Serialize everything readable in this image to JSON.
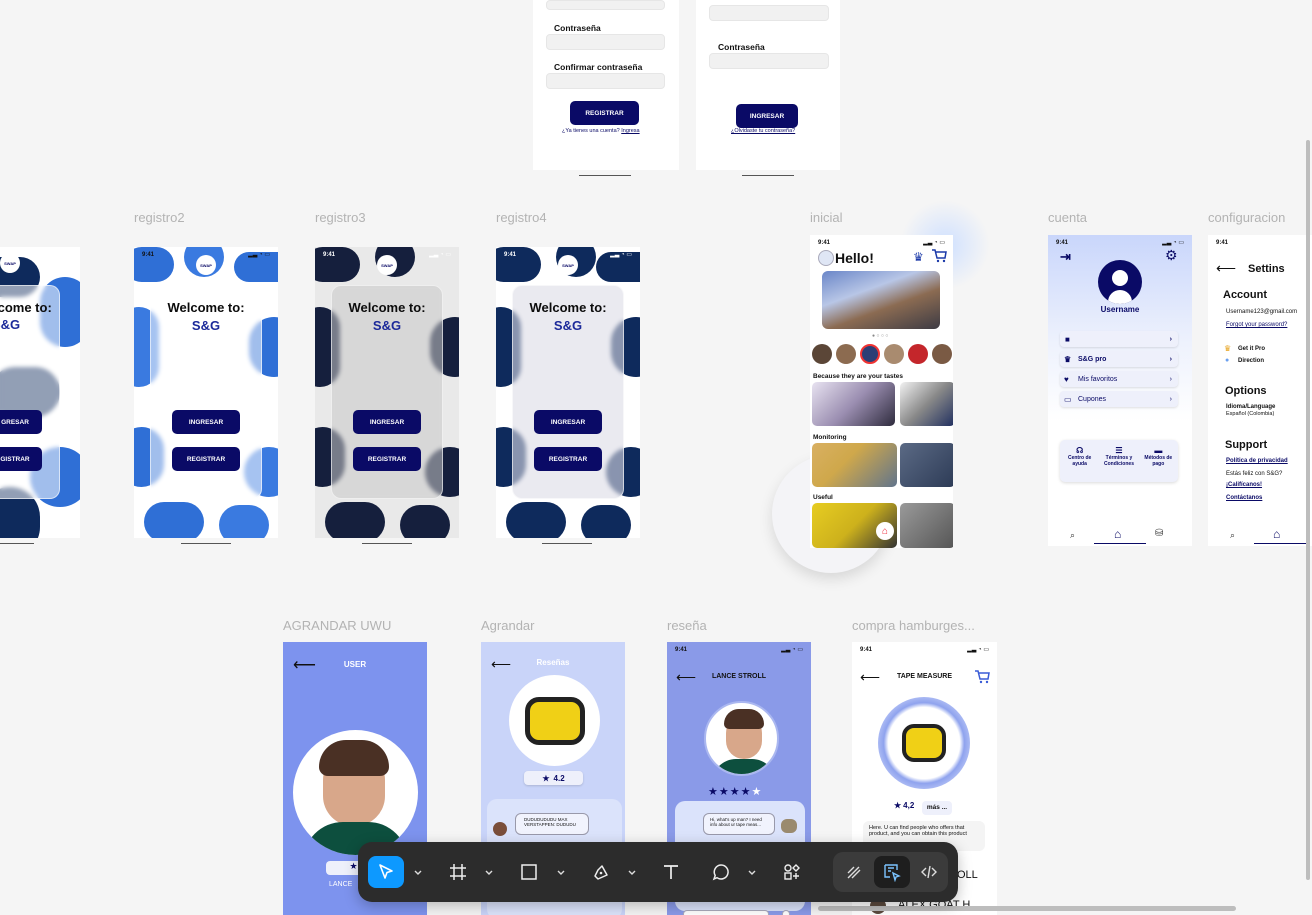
{
  "frames": {
    "top1": {
      "password_label": "Contraseña",
      "confirm_label": "Confirmar contraseña",
      "register_button": "REGISTRAR",
      "have_account": "¿Ya tienes una cuenta?",
      "login_link": "Ingresa"
    },
    "top2": {
      "password_label": "Contraseña",
      "login_button": "INGRESAR",
      "forgot": "¿Olvidaste tu contraseña?"
    },
    "row1_labels": [
      "registro2",
      "registro3",
      "registro4",
      "inicial",
      "cuenta",
      "configuracion"
    ],
    "welcome": {
      "title": "Welcome to:",
      "brand": "S&G",
      "login": "INGRESAR",
      "register": "REGISTRAR",
      "time": "9:41",
      "logo": "SWAP",
      "partial_title": "lcome to:",
      "partial_brand": "S&G",
      "partial_login": "GRESAR",
      "partial_register": "GISTRAR"
    },
    "inicial": {
      "time": "9:41",
      "greeting": "Hello!",
      "section1": "Because they are your tastes",
      "section2": "Monitoring",
      "section3": "Useful"
    },
    "cuenta": {
      "time": "9:41",
      "username": "Username",
      "items": [
        "",
        "S&G pro",
        "Mis favoritos",
        "Cupones"
      ],
      "help": [
        "Centro de ayuda",
        "Términos y Condiciones",
        "Métodos de pago"
      ]
    },
    "config": {
      "time": "9:41",
      "title": "Settins",
      "account": "Account",
      "email": "Username123@gmail.com",
      "forgot": "Forgot your password?",
      "getpro": "Get it Pro",
      "direction": "Direction",
      "options": "Options",
      "lang_label": "Idioma/Language",
      "lang_value": "Español (Colombia)",
      "support": "Support",
      "privacy": "Política de privacidad",
      "happy": "Estás feliz con S&G?",
      "rate": "¡Califícanos!",
      "contact": "Contáctanos"
    },
    "row2_labels": [
      "AGRANDAR UWU",
      "Agrandar",
      "reseña",
      "compra hamburges..."
    ],
    "agrandar_uwu": {
      "title": "USER",
      "name": "LANCE"
    },
    "agrandar": {
      "title": "Reseñas",
      "rating": "4.2",
      "comment": "DUDUDUDUDU MAX VERSTAPPEN: DUDUDU"
    },
    "resena": {
      "time": "9:41",
      "title": "LANCE STROLL",
      "comment": "Hi, what's up man? I need info about ur tape meas..."
    },
    "compra": {
      "time": "9:41",
      "title": "TAPE MEASURE",
      "rating": "4,2",
      "more": "más ...",
      "desc": "Here. U can find people who offers that product, and you can obtain this product",
      "r1": "OLL",
      "r2": "ALEX GOAT H."
    }
  },
  "toolbar": {
    "tools": [
      "move-tool",
      "frame-tool",
      "shape-tool",
      "pen-tool",
      "text-tool",
      "comment-tool",
      "actions-tool",
      "draw-mode",
      "design-mode",
      "dev-mode"
    ]
  },
  "colors": {
    "navy": "#0a0a66",
    "periwinkle": "#8a9ae8",
    "lightblue": "#c6d1f8",
    "toolbar": "#2c2c2c",
    "accent": "#0d99ff"
  }
}
